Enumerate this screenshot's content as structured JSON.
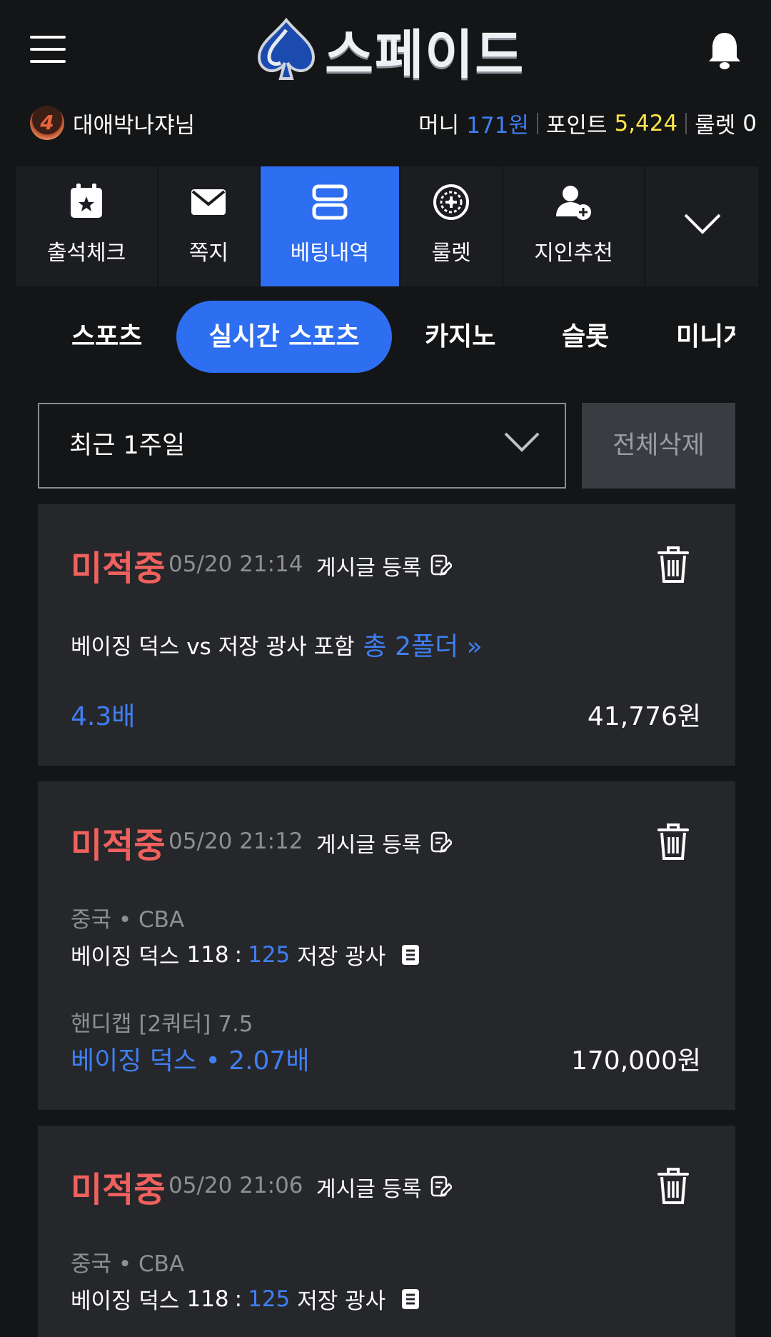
{
  "header": {
    "logo_text": "스페이드"
  },
  "user": {
    "level": "4",
    "name": "대애박나쟈님",
    "money_label": "머니",
    "money_value": "171원",
    "point_label": "포인트",
    "point_value": "5,424",
    "roulette_label": "룰렛",
    "roulette_value": "0"
  },
  "top_menu": [
    {
      "label": "출석체크",
      "icon": "calendar-star-icon",
      "active": false
    },
    {
      "label": "쪽지",
      "icon": "envelope-icon",
      "active": false
    },
    {
      "label": "베팅내역",
      "icon": "bet-history-icon",
      "active": true
    },
    {
      "label": "룰렛",
      "icon": "roulette-wheel-icon",
      "active": false
    },
    {
      "label": "지인추천",
      "icon": "add-user-icon",
      "active": false
    }
  ],
  "sub_tabs": [
    {
      "label": "스포츠",
      "active": false
    },
    {
      "label": "실시간 스포츠",
      "active": true
    },
    {
      "label": "카지노",
      "active": false
    },
    {
      "label": "슬롯",
      "active": false
    },
    {
      "label": "미니게",
      "active": false
    }
  ],
  "filter": {
    "period_value": "최근 1주일",
    "delete_all_label": "전체삭제"
  },
  "bets": [
    {
      "status": "미적중",
      "time": "05/20 21:14",
      "post_label": "게시글 등록",
      "summary": "베이징 덕스 vs 저장 광사 포함",
      "folder_link": "총 2폴더 »",
      "odds": "4.3배",
      "amount": "41,776원"
    },
    {
      "status": "미적중",
      "time": "05/20 21:12",
      "post_label": "게시글 등록",
      "league": "중국 • CBA",
      "home_team": "베이징 덕스",
      "home_score": "118",
      "score_sep": ":",
      "away_score": "125",
      "away_team": "저장 광사",
      "market": "핸디캡 [2쿼터] 7.5",
      "pick": "베이징 덕스 • 2.07배",
      "amount": "170,000원"
    },
    {
      "status": "미적중",
      "time": "05/20 21:06",
      "post_label": "게시글 등록",
      "league": "중국 • CBA",
      "home_team": "베이징 덕스",
      "home_score": "118",
      "score_sep": ":",
      "away_score": "125",
      "away_team": "저장 광사"
    }
  ],
  "colors": {
    "background": "#141517",
    "accent_blue": "#2e6ef0",
    "status_red": "#f0615e",
    "point_yellow": "#ffe54a",
    "card_bg": "#26272b"
  }
}
